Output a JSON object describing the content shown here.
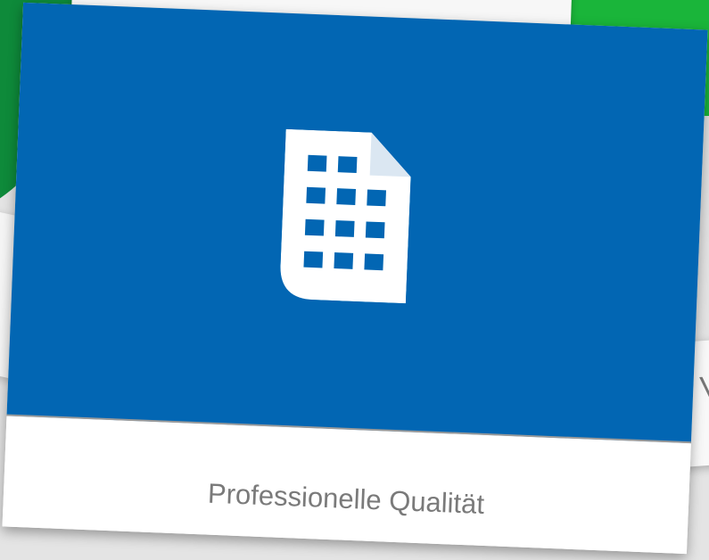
{
  "colors": {
    "card_blue": "#0266b3",
    "green_left": "#0e8a3a",
    "green_right": "#1ab53a",
    "caption_gray": "#7a7a7a"
  },
  "card": {
    "icon": "document-grid-icon",
    "caption": "Professionelle Qualität"
  },
  "background": {
    "partial_card_text": "V"
  }
}
